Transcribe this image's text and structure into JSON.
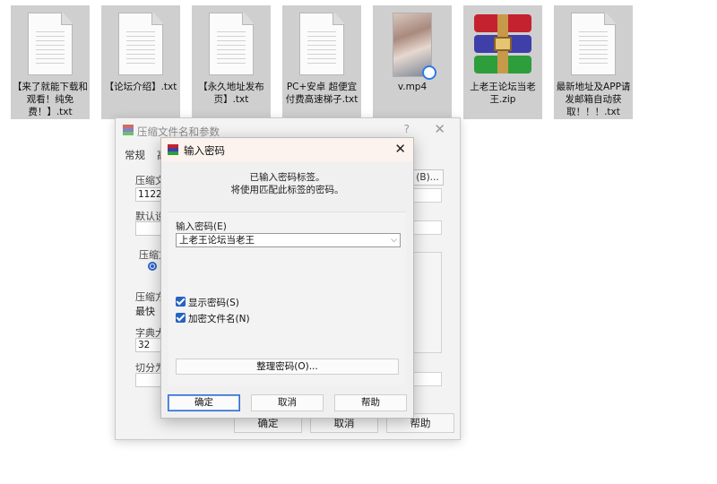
{
  "desktop": {
    "files": [
      {
        "label": "【来了就能下载和观看！纯免费！】.txt",
        "icon": "text-file-icon"
      },
      {
        "label": "【论坛介绍】.txt",
        "icon": "text-file-icon"
      },
      {
        "label": "【永久地址发布页】.txt",
        "icon": "text-file-icon"
      },
      {
        "label": "PC+安卓 超便宜付费高速梯子.txt",
        "icon": "text-file-icon"
      },
      {
        "label": "v.mp4",
        "icon": "video-file-icon"
      },
      {
        "label": "上老王论坛当老王.zip",
        "icon": "winrar-archive-icon"
      },
      {
        "label": "最新地址及APP请发邮箱自动获取！！！.txt",
        "icon": "text-file-icon"
      }
    ]
  },
  "archive_dialog": {
    "title": "压缩文件名和参数",
    "help_glyph": "?",
    "close_glyph": "✕",
    "tab_general": "常规",
    "tab_advanced_partial": "高",
    "archive_name_label_partial": "压缩文",
    "archive_name_value_partial": "1122lll",
    "default_profile_label_partial": "默认设置",
    "format_group_label_partial": "压缩文",
    "method_label_partial": "压缩方",
    "method_value": "最快",
    "dict_label_partial": "字典大",
    "dict_value": "32",
    "split_label_partial": "切分为",
    "browse_button_partial": "(B)...",
    "ok_button": "确定",
    "cancel_button": "取消",
    "help_button": "帮助"
  },
  "password_dialog": {
    "title": "输入密码",
    "close_glyph": "✕",
    "message_line1": "已输入密码标签。",
    "message_line2": "将使用匹配此标签的密码。",
    "password_label": "输入密码(E)",
    "password_value": "上老王论坛当老王",
    "show_password_label": "显示密码(S)",
    "show_password_checked": true,
    "encrypt_names_label": "加密文件名(N)",
    "encrypt_names_checked": true,
    "manage_button": "整理密码(O)...",
    "ok_button": "确定",
    "cancel_button": "取消",
    "help_button": "帮助"
  }
}
